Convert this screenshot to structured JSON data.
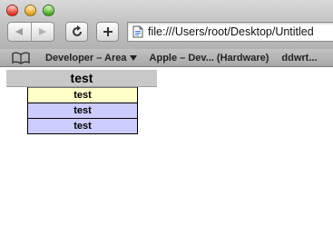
{
  "toolbar": {
    "url": "file:///Users/root/Desktop/Untitled"
  },
  "bookmarks": {
    "items": [
      {
        "label": "Developer – Area"
      },
      {
        "label": "Apple – Dev... (Hardware)"
      },
      {
        "label": "ddwrt..."
      }
    ]
  },
  "page": {
    "header": "test",
    "rows": [
      {
        "label": "test",
        "bg": "#ffffc8"
      },
      {
        "label": "test",
        "bg": "#ccccff"
      },
      {
        "label": "test",
        "bg": "#ccccff"
      }
    ]
  }
}
